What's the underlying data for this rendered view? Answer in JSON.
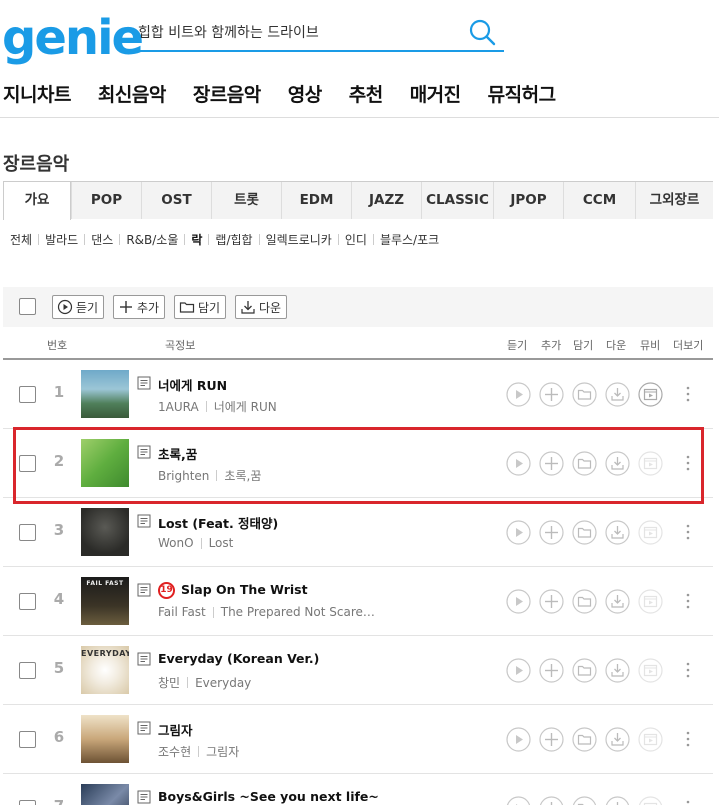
{
  "header": {
    "logo": "genie",
    "search_placeholder": "힙합 비트와 함께하는 드라이브"
  },
  "nav": [
    "지니차트",
    "최신음악",
    "장르음악",
    "영상",
    "추천",
    "매거진",
    "뮤직허그"
  ],
  "page_title": "장르음악",
  "genre_tabs": [
    "가요",
    "POP",
    "OST",
    "트롯",
    "EDM",
    "JAZZ",
    "CLASSIC",
    "JPOP",
    "CCM",
    "그외장르"
  ],
  "active_tab": "가요",
  "subgenres": [
    "전체",
    "발라드",
    "댄스",
    "R&B/소울",
    "락",
    "랩/힙합",
    "일렉트로니카",
    "인디",
    "블루스/포크"
  ],
  "active_subgenre": "락",
  "toolbar": {
    "listen": "듣기",
    "add": "추가",
    "save": "담기",
    "download": "다운"
  },
  "list_header": {
    "number": "번호",
    "song_info": "곡정보",
    "listen": "듣기",
    "add": "추가",
    "save": "담기",
    "download": "다운",
    "mv": "뮤비",
    "more": "더보기"
  },
  "songs": [
    {
      "number": "1",
      "title": "너에게 RUN",
      "artist": "1AURA",
      "album": "너에게 RUN",
      "age_badge": "",
      "has_mv": true
    },
    {
      "number": "2",
      "title": "초록,꿈",
      "artist": "Brighten",
      "album": "초록,꿈",
      "age_badge": "",
      "has_mv": false
    },
    {
      "number": "3",
      "title": "Lost (Feat. 정태양)",
      "artist": "WonO",
      "album": "Lost",
      "age_badge": "",
      "has_mv": false
    },
    {
      "number": "4",
      "title": "Slap On The Wrist",
      "artist": "Fail Fast",
      "album": "The Prepared Not Scare…",
      "age_badge": "19",
      "has_mv": false,
      "cover_text": "FAIL FAST"
    },
    {
      "number": "5",
      "title": "Everyday (Korean Ver.)",
      "artist": "창민",
      "album": "Everyday",
      "age_badge": "",
      "has_mv": false,
      "cover_text": "EVERYDAY"
    },
    {
      "number": "6",
      "title": "그림자",
      "artist": "조수현",
      "album": "그림자",
      "age_badge": "",
      "has_mv": false
    },
    {
      "number": "7",
      "title": "Boys&Girls ~See you next life~",
      "artist": "",
      "album": "",
      "age_badge": "",
      "has_mv": false
    }
  ],
  "colors": {
    "brand": "#1a9be6",
    "highlight": "#d9262c",
    "age_badge": "#e02020"
  }
}
